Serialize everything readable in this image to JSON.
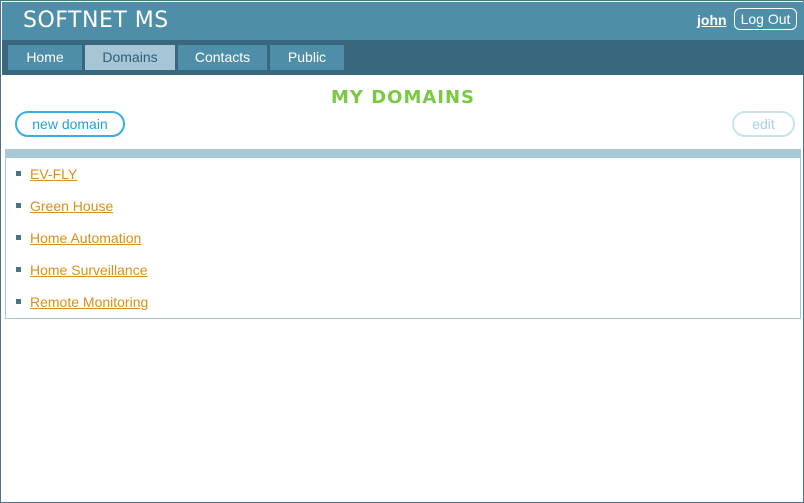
{
  "header": {
    "app_title": "SOFTNET MS",
    "user": "john",
    "logout_label": "Log Out"
  },
  "nav": {
    "tabs": [
      {
        "label": "Home",
        "active": false
      },
      {
        "label": "Domains",
        "active": true
      },
      {
        "label": "Contacts",
        "active": false
      },
      {
        "label": "Public",
        "active": false
      }
    ]
  },
  "main": {
    "title": "MY DOMAINS",
    "new_domain_label": "new domain",
    "edit_label": "edit",
    "domains": [
      "EV-FLY",
      "Green House",
      "Home Automation",
      "Home Surveillance",
      "Remote Monitoring"
    ]
  },
  "colors": {
    "header_bg": "#4f8ea9",
    "nav_bg": "#38677e",
    "active_tab_bg": "#a6c6d5",
    "title_green": "#7ac943",
    "link_orange": "#d78f1e",
    "button_blue": "#3aaee0"
  }
}
